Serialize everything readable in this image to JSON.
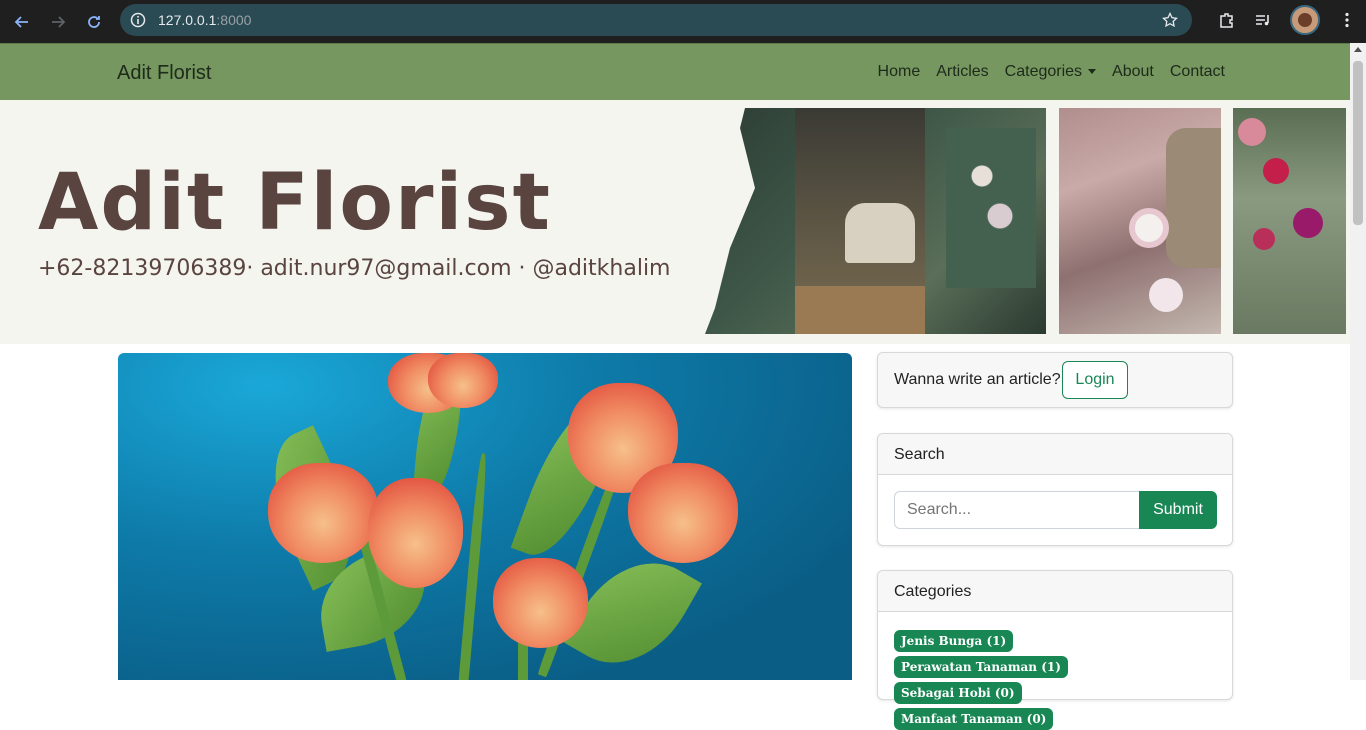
{
  "browser": {
    "url_host": "127.0.0.1",
    "url_port": ":8000"
  },
  "navbar": {
    "brand": "Adit Florist",
    "items": [
      {
        "label": "Home"
      },
      {
        "label": "Articles"
      },
      {
        "label": "Categories"
      },
      {
        "label": "About"
      },
      {
        "label": "Contact"
      }
    ]
  },
  "banner": {
    "title": "Adit Florist",
    "contact": "+62-82139706389· adit.nur97@gmail.com · @aditkhalim"
  },
  "sidebar": {
    "login_prompt": "Wanna write an article?",
    "login_button": "Login",
    "search_header": "Search",
    "search_placeholder": "Search...",
    "submit_button": "Submit",
    "categories_header": "Categories",
    "categories": [
      {
        "label": "Jenis Bunga (1)"
      },
      {
        "label": "Perawatan Tanaman (1)"
      },
      {
        "label": "Sebagai Hobi (0)"
      },
      {
        "label": "Manfaat Tanaman (0)"
      }
    ]
  },
  "colors": {
    "navbar": "#76975f",
    "accent": "#198754",
    "banner_text": "#5a4440"
  }
}
